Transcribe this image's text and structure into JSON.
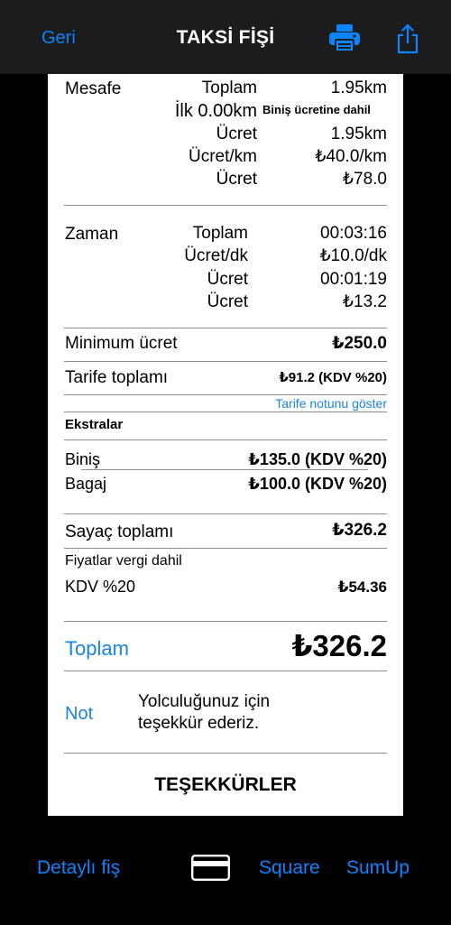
{
  "nav": {
    "back_label": "Geri",
    "title": "TAKSİ FİŞİ",
    "print_icon": "printer-icon",
    "share_icon": "share-icon"
  },
  "distance": {
    "label": "Mesafe",
    "total_label": "Toplam",
    "total_value": "1.95km",
    "first_label": "İlk 0.00km",
    "first_value": "Biniş ücretine dahil",
    "fee_label": "Ücret",
    "fee_value": "1.95km",
    "rate_label": "Ücret/km",
    "rate_value": "₺40.0/km",
    "amount_label": "Ücret",
    "amount_value": "₺78.0"
  },
  "time": {
    "label": "Zaman",
    "total_label": "Toplam",
    "total_value": "00:03:16",
    "rate_label": "Ücret/dk",
    "rate_value": "₺10.0/dk",
    "fee_label": "Ücret",
    "fee_value": "00:01:19",
    "amount_label": "Ücret",
    "amount_value": "₺13.2"
  },
  "minimum": {
    "label": "Minimum ücret",
    "value": "₺250.0"
  },
  "tariff": {
    "label": "Tarife toplamı",
    "value": "₺91.2 (KDV %20)",
    "note_link": "Tarife notunu göster"
  },
  "extras": {
    "heading": "Ekstralar",
    "items": [
      {
        "label": "Biniş",
        "value": "₺135.0 (KDV %20)"
      },
      {
        "label": "Bagaj",
        "value": "₺100.0 (KDV %20)"
      }
    ]
  },
  "meter": {
    "label": "Sayaç toplamı",
    "value": "₺326.2",
    "tax_note": "Fiyatlar vergi dahil",
    "vat_label": "KDV %20",
    "vat_value": "₺54.36"
  },
  "total": {
    "label": "Toplam",
    "value": "₺326.2"
  },
  "note": {
    "label": "Not",
    "text_line1": "Yolculuğunuz için",
    "text_line2": "teşekkür ederiz."
  },
  "thanks": "TEŞEKKÜRLER",
  "bottom": {
    "detailed": "Detaylı fiş",
    "card_icon": "credit-card-icon",
    "square": "Square",
    "sumup": "SumUp"
  }
}
